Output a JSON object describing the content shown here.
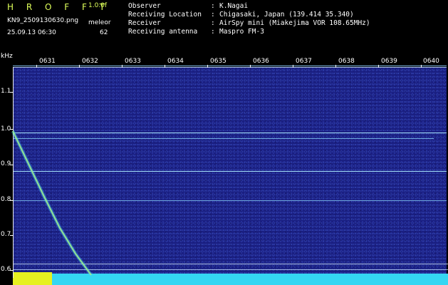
{
  "header": {
    "brand": "H R O F F T",
    "version": "1.0.0f",
    "filename": "KN9_2509130630.png",
    "meteor_label": "meleor",
    "datetime": "25.09.13 06:30",
    "meteor_count": "62",
    "fields": [
      {
        "label": "Observer",
        "sep": ":",
        "value": "K.Nagai"
      },
      {
        "label": "Receiving Location",
        "sep": ":",
        "value": "Chigasaki, Japan (139.414 35.340)"
      },
      {
        "label": "Receiver",
        "sep": ":",
        "value": "AirSpy mini (Miakejima VOR 108.65MHz)"
      },
      {
        "label": "Receiving antenna",
        "sep": ":",
        "value": "Maspro FM-3"
      }
    ]
  },
  "plot": {
    "y_unit": "kHz",
    "y_ticks": [
      "1.1",
      "1.0",
      "0.9",
      "0.8",
      "0.7",
      "0.6"
    ],
    "x_ticks": [
      "0631",
      "0632",
      "0633",
      "0634",
      "0635",
      "0636",
      "0637",
      "0638",
      "0639",
      "0640"
    ],
    "colors": {
      "background": "#1a1f82",
      "signal": "#9fdcff",
      "meteor": "#c8ff5a",
      "floor": "#34d6f2",
      "floor_highlight": "#e6f020"
    }
  }
}
